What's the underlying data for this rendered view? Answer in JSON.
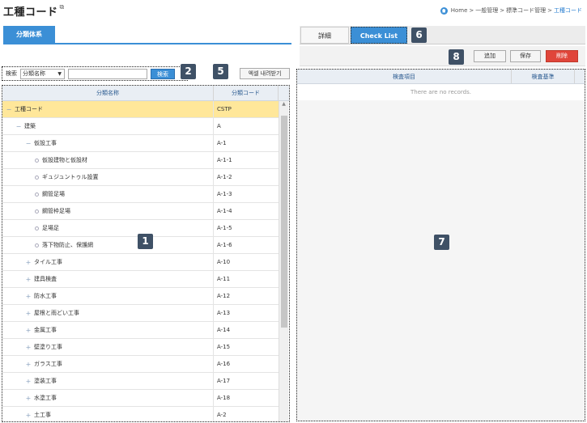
{
  "page": {
    "title": "工種コード",
    "breadcrumb": [
      "Home",
      ">",
      "一般管理",
      ">",
      "標準コード管理",
      ">",
      "工種コード"
    ]
  },
  "left_panel": {
    "tab_label": "分類体系",
    "search": {
      "label": "検索",
      "select_value": "分類名称",
      "input_value": "",
      "button_label": "検索"
    },
    "excel_button": "엑셀 내려받기",
    "grid": {
      "columns": [
        "分類名称",
        "分類コード"
      ],
      "rows": [
        {
          "toggle": "−",
          "level": 0,
          "name": "工種コード",
          "code": "CSTP",
          "selected": true
        },
        {
          "toggle": "−",
          "level": 1,
          "name": "建築",
          "code": "A",
          "selected": false
        },
        {
          "toggle": "−",
          "level": 2,
          "name": "仮設工事",
          "code": "A-1",
          "selected": false
        },
        {
          "toggle": "leaf",
          "level": 3,
          "name": "仮設建物と仮設材",
          "code": "A-1-1",
          "selected": false
        },
        {
          "toggle": "leaf",
          "level": 3,
          "name": "ギュジュントゥル設置",
          "code": "A-1-2",
          "selected": false
        },
        {
          "toggle": "leaf",
          "level": 3,
          "name": "鋼管足場",
          "code": "A-1-3",
          "selected": false
        },
        {
          "toggle": "leaf",
          "level": 3,
          "name": "鋼管枠足場",
          "code": "A-1-4",
          "selected": false
        },
        {
          "toggle": "leaf",
          "level": 3,
          "name": "足場足",
          "code": "A-1-5",
          "selected": false
        },
        {
          "toggle": "leaf",
          "level": 3,
          "name": "落下物防止、保護網",
          "code": "A-1-6",
          "selected": false
        },
        {
          "toggle": "+",
          "level": 2,
          "name": "タイル工事",
          "code": "A-10",
          "selected": false
        },
        {
          "toggle": "+",
          "level": 2,
          "name": "建具検査",
          "code": "A-11",
          "selected": false
        },
        {
          "toggle": "+",
          "level": 2,
          "name": "防水工事",
          "code": "A-12",
          "selected": false
        },
        {
          "toggle": "+",
          "level": 2,
          "name": "屋根と雨どい工事",
          "code": "A-13",
          "selected": false
        },
        {
          "toggle": "+",
          "level": 2,
          "name": "金属工事",
          "code": "A-14",
          "selected": false
        },
        {
          "toggle": "+",
          "level": 2,
          "name": "壁塗り工事",
          "code": "A-15",
          "selected": false
        },
        {
          "toggle": "+",
          "level": 2,
          "name": "ガラス工事",
          "code": "A-16",
          "selected": false
        },
        {
          "toggle": "+",
          "level": 2,
          "name": "塗装工事",
          "code": "A-17",
          "selected": false
        },
        {
          "toggle": "+",
          "level": 2,
          "name": "水塗工事",
          "code": "A-18",
          "selected": false
        },
        {
          "toggle": "+",
          "level": 2,
          "name": "土工事",
          "code": "A-2",
          "selected": false
        }
      ]
    }
  },
  "right_panel": {
    "tabs": [
      {
        "label": "詳細",
        "active": false
      },
      {
        "label": "Check List",
        "active": true
      }
    ],
    "buttons": {
      "add": "追加",
      "save": "保存",
      "delete": "削除"
    },
    "grid": {
      "columns": [
        "検査項目",
        "検査基準"
      ],
      "empty_text": "There are no records."
    }
  },
  "badges": [
    "1",
    "2",
    "5",
    "6",
    "7",
    "8"
  ],
  "colors": {
    "accent": "#3b8fd6",
    "selected_row": "#ffe79a",
    "delete": "#e0453a",
    "badge": "#3f5166"
  }
}
